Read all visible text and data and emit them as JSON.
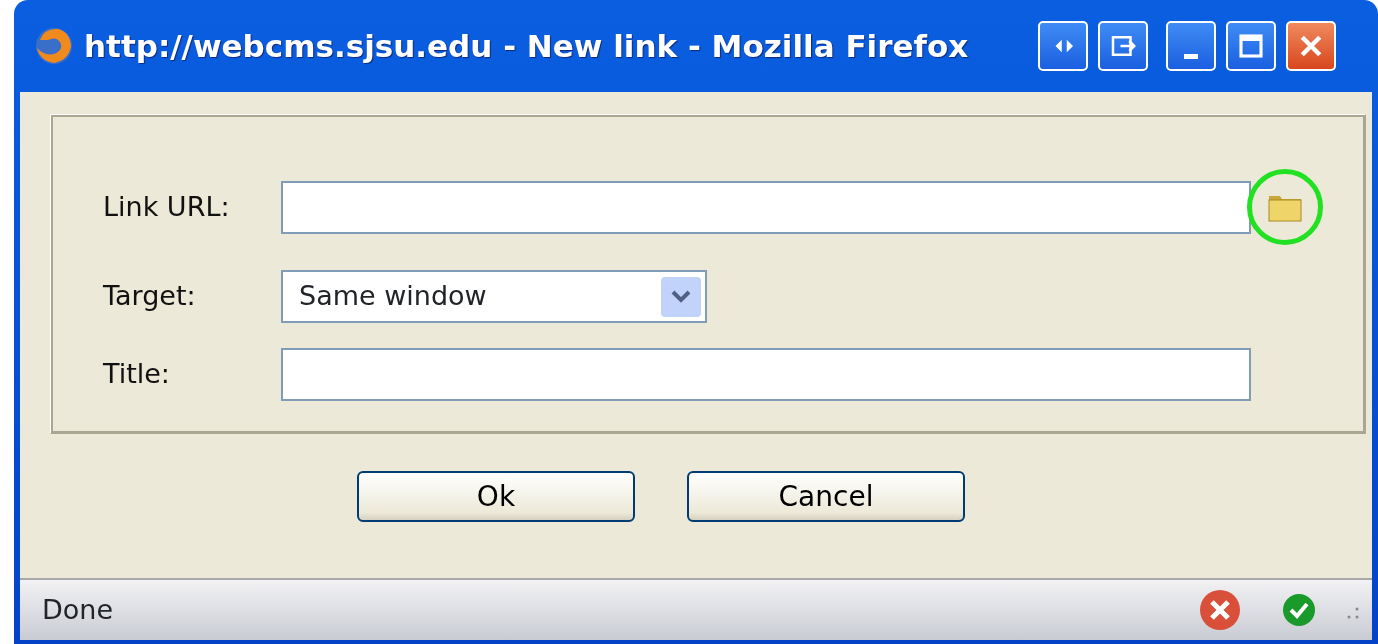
{
  "window": {
    "title": "http://webcms.sjsu.edu - New link - Mozilla Firefox"
  },
  "form": {
    "fields": [
      {
        "kind": "text",
        "label": "Link URL:",
        "browse": true,
        "highlighted": true
      },
      {
        "kind": "select",
        "label": "Target:",
        "value": "Same window"
      },
      {
        "kind": "text",
        "label": "Title:"
      }
    ]
  },
  "buttons": [
    "Ok",
    "Cancel"
  ],
  "status_bar": {
    "text": "Done"
  }
}
